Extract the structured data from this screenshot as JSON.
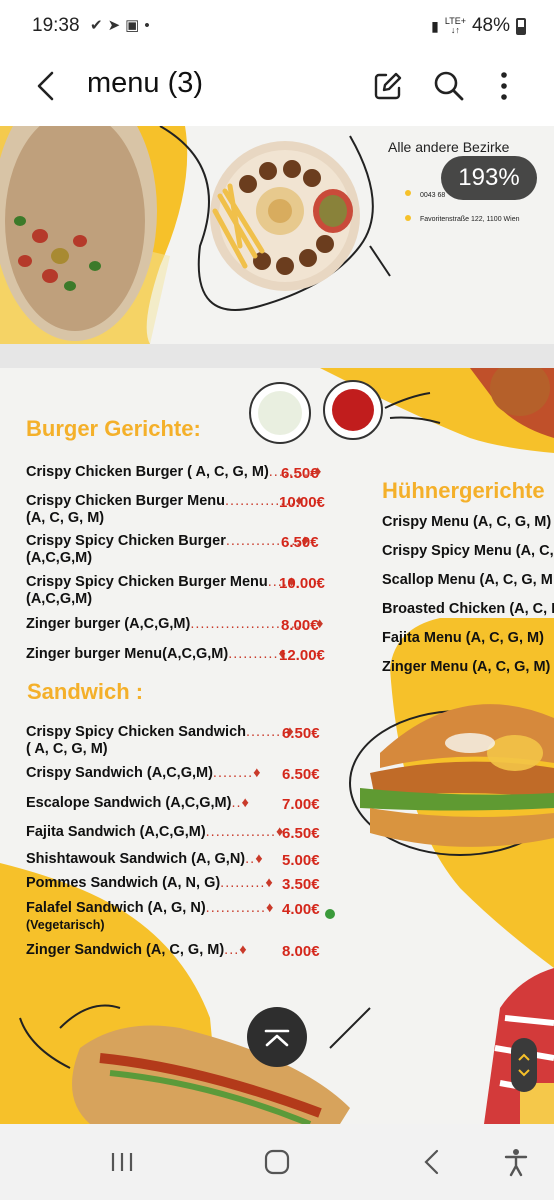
{
  "status": {
    "time": "19:38",
    "icons": [
      "check-icon",
      "telegram-icon",
      "gallery-icon",
      "dot-icon"
    ],
    "network": "LTE+",
    "battery": "48%"
  },
  "appbar": {
    "title": "menu (3)",
    "actions": [
      "edit-icon",
      "search-icon",
      "more-icon"
    ]
  },
  "zoom": "193%",
  "page1": {
    "heading": "Alle andere Bezirke",
    "phone": "0043 68",
    "address": "Favoritenstraße 122, 1100 Wien"
  },
  "burger": {
    "title": "Burger Gerichte:",
    "items": [
      {
        "name": "Crispy Chicken Burger ( A, C, G, M)",
        "price": "6.50€"
      },
      {
        "name": "Crispy Chicken Burger Menu",
        "allergens": "(A, C, G, M)",
        "price": "10.00€"
      },
      {
        "name": "Crispy Spicy Chicken Burger",
        "allergens": "(A,C,G,M)",
        "price": "6.50€"
      },
      {
        "name": "Crispy Spicy Chicken Burger Menu",
        "allergens": "(A,C,G,M)",
        "price": "10.00€"
      },
      {
        "name": "Zinger burger (A,C,G,M)",
        "price": "8.00€"
      },
      {
        "name": "Zinger burger Menu(A,C,G,M)",
        "price": "12.00€"
      }
    ]
  },
  "sandwich": {
    "title": "Sandwich :",
    "items": [
      {
        "name": "Crispy Spicy Chicken Sandwich",
        "allergens": "( A, C, G, M)",
        "price": "6.50€"
      },
      {
        "name": "Crispy Sandwich (A,C,G,M)",
        "price": "6.50€"
      },
      {
        "name": "Escalope Sandwich (A,C,G,M)",
        "price": "7.00€"
      },
      {
        "name": "Fajita Sandwich (A,C,G,M)",
        "price": "6.50€"
      },
      {
        "name": "Shishtawouk Sandwich (A, G,N)",
        "price": "5.00€"
      },
      {
        "name": "Pommes Sandwich (A, N, G)",
        "price": "3.50€"
      },
      {
        "name": "Falafel Sandwich (A, G, N)",
        "allergens": "(Vegetarisch)",
        "price": "4.00€"
      },
      {
        "name": "Zinger Sandwich (A, C, G, M)",
        "price": "8.00€"
      }
    ]
  },
  "chicken": {
    "title": "Hühnergerichte",
    "items": [
      "Crispy Menu (A, C, G, M)",
      "Crispy Spicy Menu (A, C,",
      "Scallop Menu (A, C, G, M",
      "Broasted Chicken (A, C, M",
      "Fajita Menu (A, C, G, M)",
      "Zinger Menu (A, C, G, M)"
    ]
  },
  "colors": {
    "accent_yellow": "#f6c12a",
    "price_red": "#d4271b",
    "title_yellow": "#f4b02a"
  },
  "navbar": [
    "recents-icon",
    "home-icon",
    "back-icon",
    "accessibility-icon"
  ]
}
